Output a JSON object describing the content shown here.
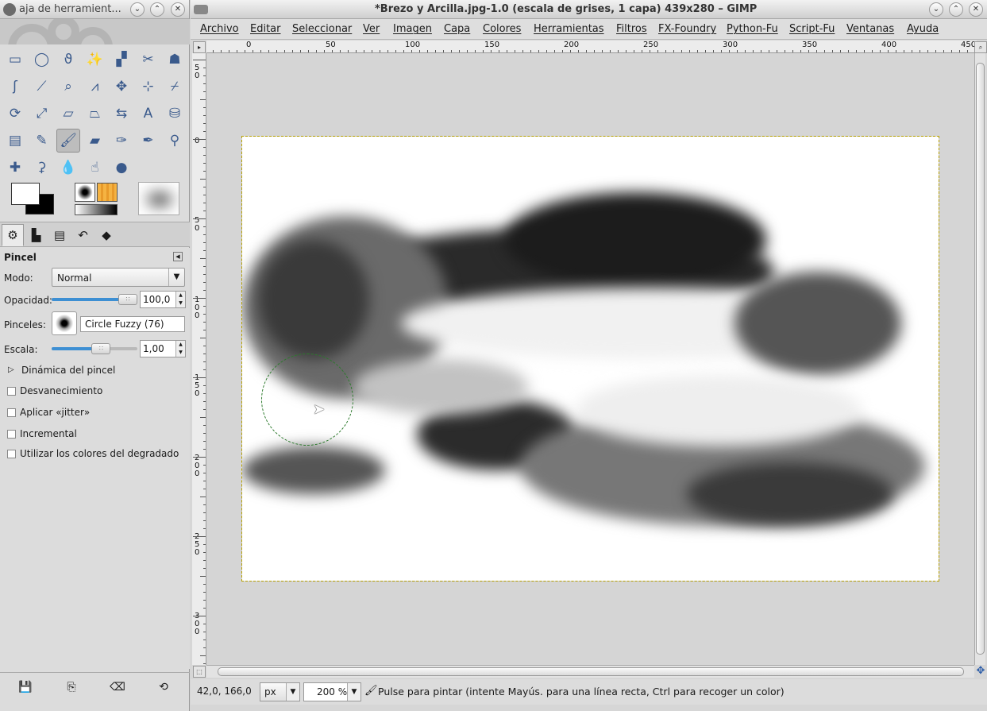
{
  "toolbox": {
    "title": "aja de herramient...",
    "tools": [
      {
        "name": "rect-select-icon",
        "glyph": "▭"
      },
      {
        "name": "ellipse-select-icon",
        "glyph": "◯"
      },
      {
        "name": "free-select-icon",
        "glyph": "ϑ"
      },
      {
        "name": "fuzzy-select-icon",
        "glyph": "✨"
      },
      {
        "name": "color-select-icon",
        "glyph": "▞"
      },
      {
        "name": "scissors-select-icon",
        "glyph": "✂"
      },
      {
        "name": "foreground-select-icon",
        "glyph": "☗"
      },
      {
        "name": "paths-icon",
        "glyph": "ʃ"
      },
      {
        "name": "color-picker-icon",
        "glyph": "⟋"
      },
      {
        "name": "zoom-icon",
        "glyph": "⌕"
      },
      {
        "name": "measure-icon",
        "glyph": "⩘"
      },
      {
        "name": "move-icon",
        "glyph": "✥"
      },
      {
        "name": "align-icon",
        "glyph": "⊹"
      },
      {
        "name": "crop-icon",
        "glyph": "⌿"
      },
      {
        "name": "rotate-icon",
        "glyph": "⟳"
      },
      {
        "name": "scale-icon",
        "glyph": "⤢"
      },
      {
        "name": "shear-icon",
        "glyph": "▱"
      },
      {
        "name": "perspective-icon",
        "glyph": "⏢"
      },
      {
        "name": "flip-icon",
        "glyph": "⇆"
      },
      {
        "name": "text-icon",
        "glyph": "A"
      },
      {
        "name": "bucket-fill-icon",
        "glyph": "⛁"
      },
      {
        "name": "blend-icon",
        "glyph": "▤"
      },
      {
        "name": "pencil-icon",
        "glyph": "✎"
      },
      {
        "name": "paintbrush-icon",
        "glyph": "🖌",
        "active": true
      },
      {
        "name": "eraser-icon",
        "glyph": "▰"
      },
      {
        "name": "airbrush-icon",
        "glyph": "✑"
      },
      {
        "name": "ink-icon",
        "glyph": "✒"
      },
      {
        "name": "clone-icon",
        "glyph": "⚲"
      },
      {
        "name": "heal-icon",
        "glyph": "✚"
      },
      {
        "name": "perspective-clone-icon",
        "glyph": "⚳"
      },
      {
        "name": "blur-icon",
        "glyph": "💧"
      },
      {
        "name": "smudge-icon",
        "glyph": "☝"
      },
      {
        "name": "dodge-burn-icon",
        "glyph": "●"
      }
    ],
    "dock_tabs": [
      {
        "name": "tool-options-tab",
        "glyph": "⚙",
        "active": true
      },
      {
        "name": "device-status-tab",
        "glyph": "▙"
      },
      {
        "name": "images-tab",
        "glyph": "▤"
      },
      {
        "name": "undo-history-tab",
        "glyph": "↶"
      },
      {
        "name": "layers-tab",
        "glyph": "◆"
      }
    ],
    "options": {
      "title": "Pincel",
      "mode_label": "Modo:",
      "mode_value": "Normal",
      "opacity_label": "Opacidad:",
      "opacity_value": "100,0",
      "opacity_fraction": 1.0,
      "brushes_label": "Pinceles:",
      "brush_name": "Circle Fuzzy (76)",
      "scale_label": "Escala:",
      "scale_value": "1,00",
      "scale_fraction": 0.6,
      "dynamics_label": "Dinámica del pincel",
      "checkboxes": [
        "Desvanecimiento",
        "Aplicar «jitter»",
        "Incremental",
        "Utilizar los colores del degradado"
      ]
    }
  },
  "window": {
    "title": "*Brezo y Arcilla.jpg-1.0 (escala de grises, 1 capa) 439x280 – GIMP",
    "menu": [
      "Archivo",
      "Editar",
      "Seleccionar",
      "Ver",
      "Imagen",
      "Capa",
      "Colores",
      "Herramientas",
      "Filtros",
      "FX-Foundry",
      "Python-Fu",
      "Script-Fu",
      "Ventanas",
      "Ayuda"
    ]
  },
  "rulers": {
    "horizontal": [
      "0",
      "50",
      "100",
      "150",
      "200",
      "250",
      "300",
      "350",
      "400",
      "450"
    ],
    "vertical": [
      "50",
      "0",
      "50",
      "100",
      "150",
      "200",
      "250",
      "300"
    ]
  },
  "status": {
    "coords": "42,0, 166,0",
    "unit": "px",
    "zoom": "200 %",
    "message": "Pulse para pintar (intente Mayús. para una línea recta, Ctrl para recoger un color)"
  }
}
